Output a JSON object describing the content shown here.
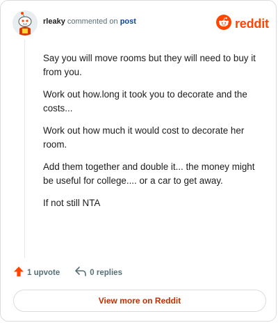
{
  "header": {
    "username": "rleaky",
    "action_text": "commented on",
    "post_link": "post",
    "brand": "reddit"
  },
  "comment": {
    "paragraphs": [
      "Say you will move rooms but they will need to buy it from you.",
      "Work out how.long it took you to decorate and the costs...",
      "Work out how much it would cost to decorate her room.",
      "Add them together and double it... the money might be useful for college.... or a car to get away.",
      "If not still NTA"
    ]
  },
  "actions": {
    "upvotes": "1 upvote",
    "replies": "0 replies"
  },
  "footer": {
    "view_more": "View more on Reddit"
  },
  "colors": {
    "brand": "#ff4500",
    "upvote": "#ff4500",
    "link": "#0a449b",
    "view_more": "#bf3100"
  },
  "icons": [
    "avatar",
    "reddit-logo-icon",
    "upvote-icon",
    "reply-icon"
  ]
}
